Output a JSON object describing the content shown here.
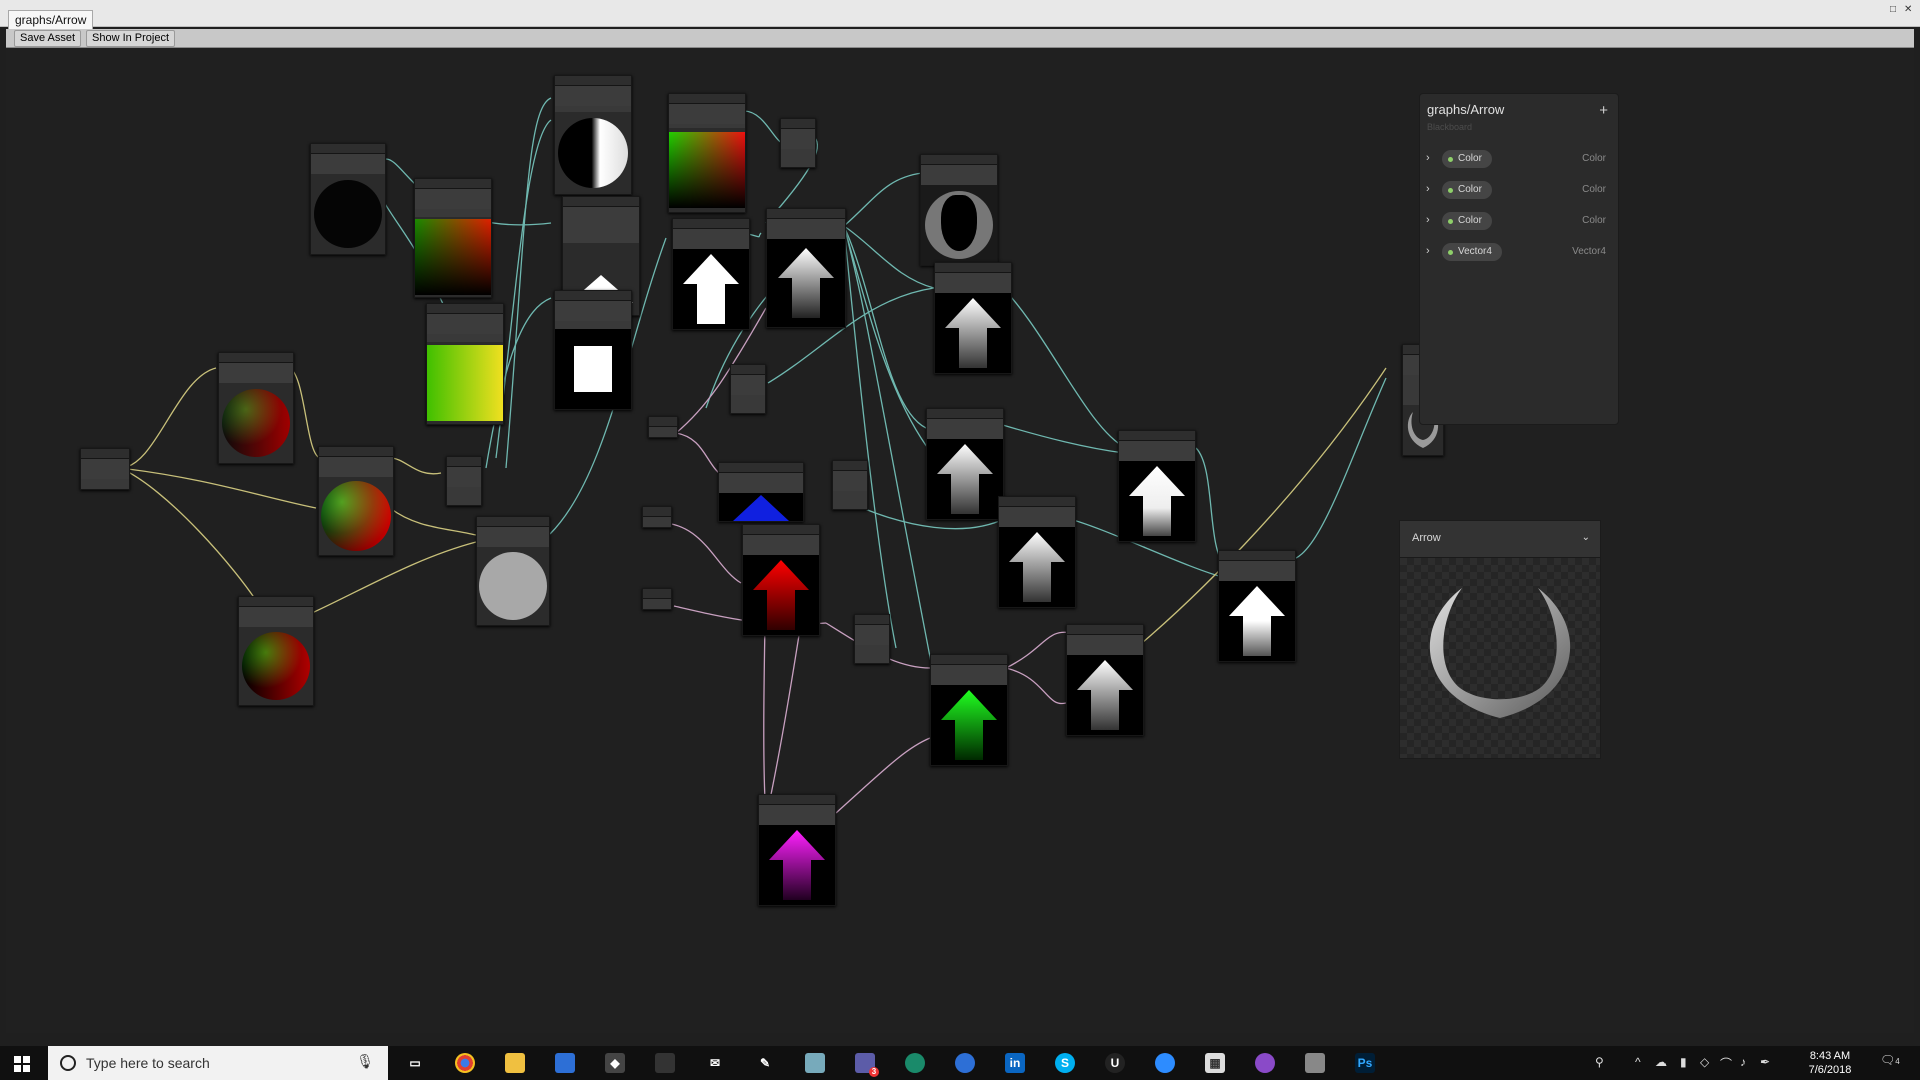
{
  "window": {
    "tab_title": "graphs/Arrow"
  },
  "toolbar": {
    "save_asset": "Save Asset",
    "show_in_project": "Show In Project"
  },
  "blackboard": {
    "title": "graphs/Arrow",
    "subtitle": "Blackboard",
    "add_symbol": "+",
    "properties": [
      {
        "name": "Color",
        "type": "Color"
      },
      {
        "name": "Color",
        "type": "Color"
      },
      {
        "name": "Color",
        "type": "Color"
      },
      {
        "name": "Vector4",
        "type": "Vector4"
      }
    ]
  },
  "master_preview": {
    "title": "Arrow"
  },
  "taskbar": {
    "search_placeholder": "Type here to search",
    "time": "8:43 AM",
    "date": "7/6/2018",
    "mail_badge": "3",
    "notifications": "4"
  },
  "colors": {
    "wire_cyan": "#6fb8b0",
    "wire_yellow": "#c8c07a",
    "wire_pink": "#c8a0c0",
    "accent_green": "#8fd06a"
  },
  "icons": [
    "windows-start-icon",
    "search-icon",
    "microphone-icon",
    "task-view-icon",
    "chrome-icon",
    "file-explorer-icon",
    "store-icon",
    "unity-icon",
    "mail-icon",
    "skype-icon",
    "linkedin-icon",
    "photoshop-icon",
    "calculator-icon",
    "notification-icon"
  ]
}
